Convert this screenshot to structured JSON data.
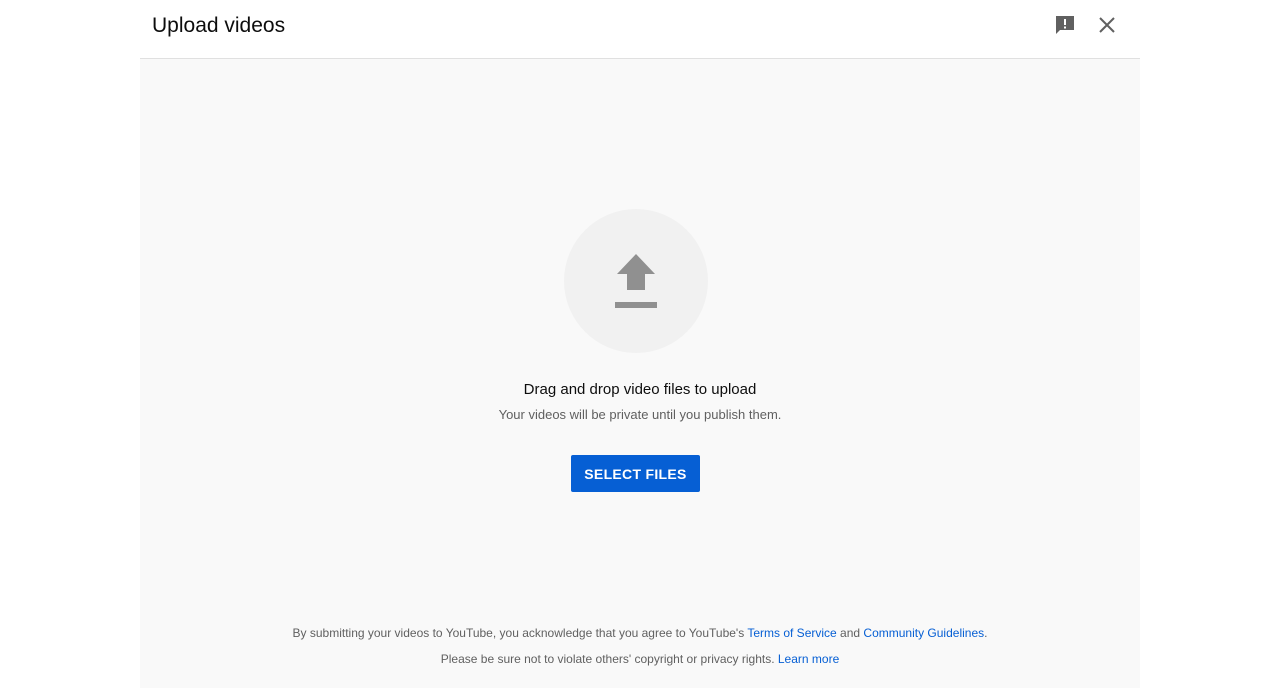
{
  "header": {
    "title": "Upload videos",
    "feedback_icon": "feedback-icon",
    "close_icon": "close-icon"
  },
  "main": {
    "upload_icon": "upload-arrow-icon",
    "drag_text": "Drag and drop video files to upload",
    "sub_text": "Your videos will be private until you publish them.",
    "select_button": "SELECT FILES"
  },
  "footer": {
    "line1_prefix": "By submitting your videos to YouTube, you acknowledge that you agree to YouTube's ",
    "terms_link": "Terms of Service",
    "line1_and": " and ",
    "guidelines_link": "Community Guidelines",
    "line1_suffix": ".",
    "line2_prefix": "Please be sure not to violate others' copyright or privacy rights. ",
    "learn_more_link": "Learn more"
  },
  "colors": {
    "accent": "#065fd4",
    "icon_gray": "#909090",
    "background": "#f9f9f9"
  }
}
